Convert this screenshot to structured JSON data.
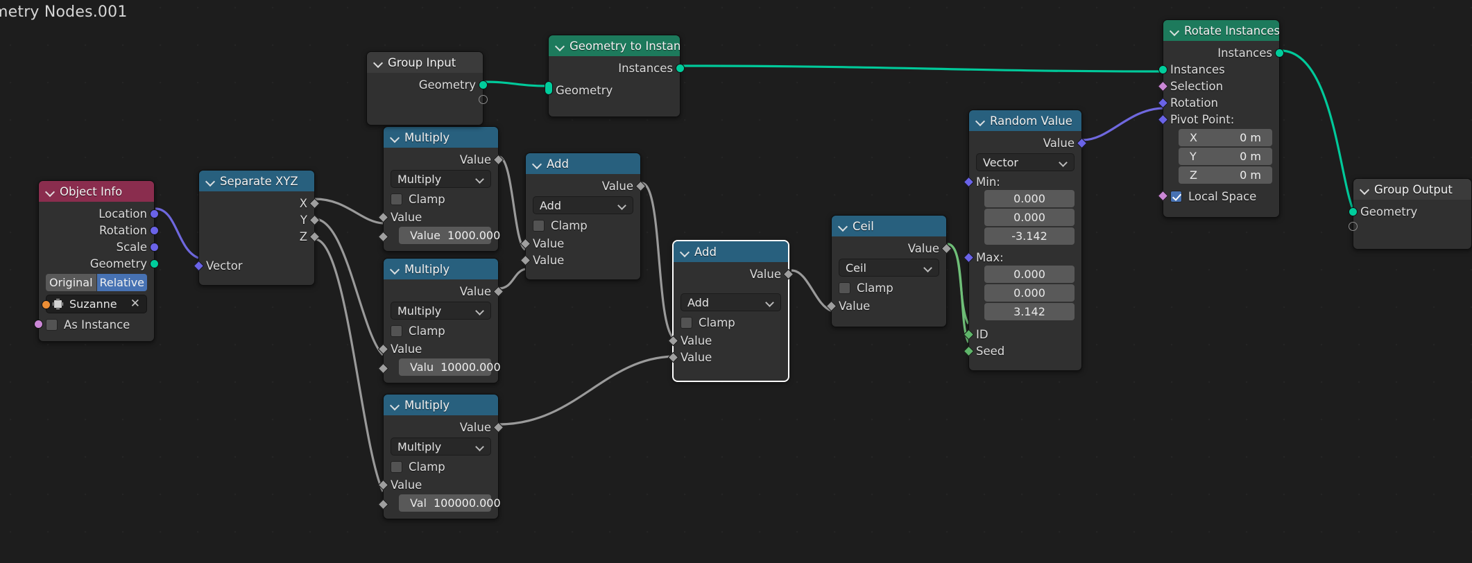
{
  "editor": {
    "title": "metry Nodes.001"
  },
  "colors": {
    "geometry_socket": "#00cd9c",
    "vector_socket": "#6a63e8",
    "field_socket": "#9f9f9f",
    "object_socket": "#ec8e35",
    "boolean_socket": "#cb87d6",
    "integer_socket": "#5fb56a",
    "header_blue": "#28607e",
    "header_green": "#1d7a5c",
    "header_crimson": "#8a2d4e",
    "header_gray": "#3b3b3b",
    "accent_active": "#4772b3",
    "background": "#1d1d1d"
  },
  "nodes": {
    "object_info": {
      "title": "Object Info",
      "outputs": [
        "Location",
        "Rotation",
        "Scale",
        "Geometry"
      ],
      "toggle": {
        "left": "Original",
        "right": "Relative",
        "active": "Relative"
      },
      "object_field": {
        "value": "Suzanne",
        "clear": "✕"
      },
      "as_instance": {
        "label": "As Instance",
        "checked": false
      }
    },
    "separate_xyz": {
      "title": "Separate XYZ",
      "outputs": [
        "X",
        "Y",
        "Z"
      ],
      "inputs": [
        "Vector"
      ]
    },
    "multiply_1": {
      "title": "Multiply",
      "output": "Value",
      "operation": "Multiply",
      "clamp": {
        "label": "Clamp",
        "checked": false
      },
      "input_label": "Value",
      "value_field": {
        "label": "Value",
        "value": "1000.000"
      }
    },
    "multiply_2": {
      "title": "Multiply",
      "output": "Value",
      "operation": "Multiply",
      "clamp": {
        "label": "Clamp",
        "checked": false
      },
      "input_label": "Value",
      "value_field": {
        "label": "Valu",
        "value": "10000.000"
      }
    },
    "multiply_3": {
      "title": "Multiply",
      "output": "Value",
      "operation": "Multiply",
      "clamp": {
        "label": "Clamp",
        "checked": false
      },
      "input_label": "Value",
      "value_field": {
        "label": "Val",
        "value": "100000.000"
      }
    },
    "add_1": {
      "title": "Add",
      "output": "Value",
      "operation": "Add",
      "clamp": {
        "label": "Clamp",
        "checked": false
      },
      "inputs": [
        "Value",
        "Value"
      ]
    },
    "add_2": {
      "title": "Add",
      "output": "Value",
      "operation": "Add",
      "clamp": {
        "label": "Clamp",
        "checked": false
      },
      "inputs": [
        "Value",
        "Value"
      ],
      "selected": true
    },
    "ceil": {
      "title": "Ceil",
      "output": "Value",
      "operation": "Ceil",
      "clamp": {
        "label": "Clamp",
        "checked": false
      },
      "input_label": "Value"
    },
    "random_value": {
      "title": "Random Value",
      "output": "Value",
      "data_type": "Vector",
      "min_label": "Min:",
      "min": [
        "0.000",
        "0.000",
        "-3.142"
      ],
      "max_label": "Max:",
      "max": [
        "0.000",
        "0.000",
        "3.142"
      ],
      "id_label": "ID",
      "seed_label": "Seed"
    },
    "group_input": {
      "title": "Group Input",
      "outputs": [
        "Geometry"
      ]
    },
    "geometry_to_instance": {
      "title": "Geometry to Instance",
      "output": "Instances",
      "input": "Geometry"
    },
    "rotate_instances": {
      "title": "Rotate Instances",
      "output": "Instances",
      "inputs": [
        "Instances",
        "Selection",
        "Rotation"
      ],
      "pivot_label": "Pivot Point:",
      "pivot": [
        {
          "axis": "X",
          "value": "0 m"
        },
        {
          "axis": "Y",
          "value": "0 m"
        },
        {
          "axis": "Z",
          "value": "0 m"
        }
      ],
      "local_space": {
        "label": "Local Space",
        "checked": true
      }
    },
    "group_output": {
      "title": "Group Output",
      "inputs": [
        "Geometry"
      ]
    }
  }
}
